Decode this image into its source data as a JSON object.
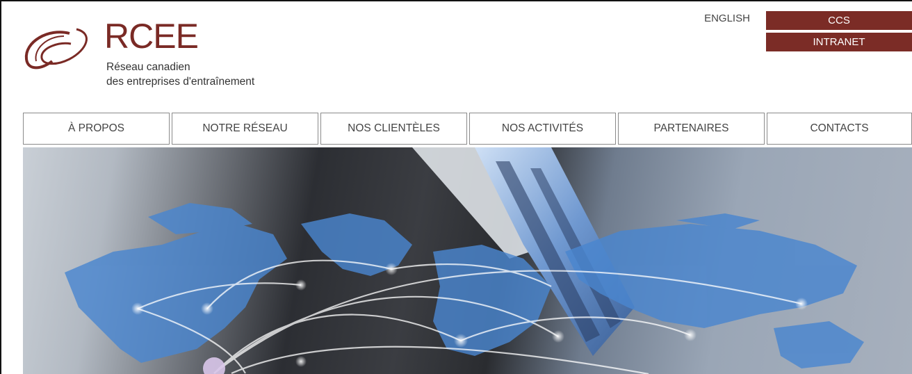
{
  "brand": {
    "title": "RCEE",
    "subtitle_line1": "Réseau canadien",
    "subtitle_line2": "des entreprises d'entraînement",
    "color": "#7a2a25"
  },
  "header": {
    "language_link": "ENGLISH",
    "buttons": [
      "CCS",
      "INTRANET"
    ],
    "button_color": "#7b2c26"
  },
  "nav": {
    "items": [
      "À PROPOS",
      "NOTRE RÉSEAU",
      "NOS CLIENTÈLES",
      "NOS ACTIVITÉS",
      "PARTENAIRES",
      "CONTACTS"
    ]
  },
  "hero": {
    "description_icon": "world-map-network-image"
  }
}
